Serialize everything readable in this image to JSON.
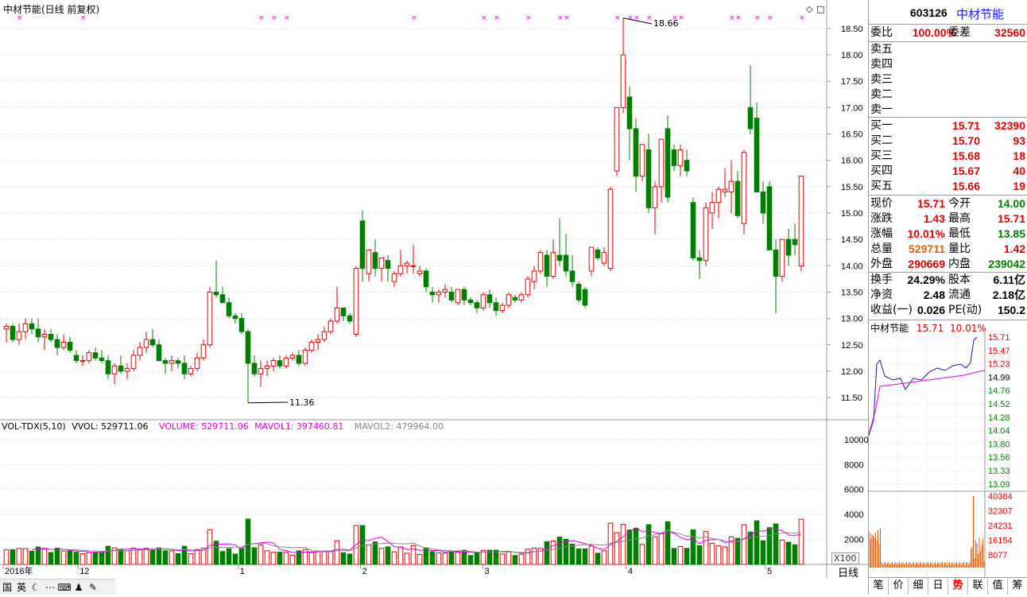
{
  "chart_title": "中材节能(日线 前复权)",
  "price_axis": [
    "18.50",
    "18.00",
    "17.50",
    "17.00",
    "16.50",
    "16.00",
    "15.50",
    "15.00",
    "14.50",
    "14.00",
    "13.50",
    "13.00",
    "12.50",
    "12.00",
    "11.50"
  ],
  "high_label": "18.66",
  "low_label": "11.36",
  "volume_header": {
    "indicator": "VOL-TDX(5,10)",
    "vvol": "VVOL: 529711.06",
    "volume": "VOLUME: 529711.06",
    "mavol1": "MAVOL1: 397460.81",
    "mavol2": "MAVOL2: 479964.00"
  },
  "vol_axis": [
    "10000",
    "8000",
    "6000",
    "4000",
    "2000"
  ],
  "vol_unit": "X100",
  "date_axis": [
    "2016年",
    "12",
    "1",
    "2",
    "3",
    "4",
    "5"
  ],
  "period_label": "日线",
  "toolbar_icons": [
    "国",
    "英",
    "moon-icon",
    "dots-icon",
    "keyboard-icon",
    "user-icon",
    "wrench-icon"
  ],
  "stock": {
    "code": "603126",
    "name": "中材节能"
  },
  "commission": {
    "ratio_label": "委比",
    "ratio": "100.00%",
    "diff_label": "委差",
    "diff": "32560"
  },
  "sell": [
    {
      "label": "卖五"
    },
    {
      "label": "卖四"
    },
    {
      "label": "卖三"
    },
    {
      "label": "卖二"
    },
    {
      "label": "卖一"
    }
  ],
  "buy": [
    {
      "label": "买一",
      "price": "15.71",
      "vol": "32390"
    },
    {
      "label": "买二",
      "price": "15.70",
      "vol": "93"
    },
    {
      "label": "买三",
      "price": "15.68",
      "vol": "18"
    },
    {
      "label": "买四",
      "price": "15.67",
      "vol": "40"
    },
    {
      "label": "买五",
      "price": "15.66",
      "vol": "19"
    }
  ],
  "quote": [
    {
      "l1": "现价",
      "v1": "15.71",
      "l2": "今开",
      "v2": "14.00",
      "c1": "red",
      "c2": "green"
    },
    {
      "l1": "涨跌",
      "v1": "1.43",
      "l2": "最高",
      "v2": "15.71",
      "c1": "red",
      "c2": "red"
    },
    {
      "l1": "涨幅",
      "v1": "10.01%",
      "l2": "最低",
      "v2": "13.85",
      "c1": "red",
      "c2": "green"
    },
    {
      "l1": "总量",
      "v1": "529711",
      "l2": "量比",
      "v2": "1.42",
      "c1": "orange",
      "c2": "red"
    },
    {
      "l1": "外盘",
      "v1": "290669",
      "l2": "内盘",
      "v2": "239042",
      "c1": "red",
      "c2": "green"
    }
  ],
  "stats": [
    {
      "l1": "换手",
      "v1": "24.29%",
      "l2": "股本",
      "v2": "6.11亿"
    },
    {
      "l1": "净资",
      "v1": "2.48",
      "l2": "流通",
      "v2": "2.18亿"
    },
    {
      "l1": "收益(一)",
      "v1": "0.026",
      "l2": "PE(动)",
      "v2": "150.2"
    }
  ],
  "mini": {
    "name": "中材节能",
    "price": "15.71",
    "pct": "10.01%",
    "price_axis": [
      "15.71",
      "15.47",
      "15.23",
      "14.99",
      "14.76",
      "14.52",
      "14.28",
      "14.04",
      "13.80",
      "13.56",
      "13.33",
      "13.09"
    ],
    "vol_axis": [
      "40384",
      "32307",
      "24231",
      "16154",
      "8077"
    ]
  },
  "tabs": [
    "笔",
    "价",
    "细",
    "日",
    "势",
    "联",
    "值",
    "筹"
  ],
  "active_tab": "势",
  "colors": {
    "up": "#e60000",
    "down": "#008000",
    "ma1": "#e600e6",
    "ma2": "#888888",
    "grid": "#cccccc",
    "axis": "#999999"
  },
  "chart_data": {
    "type": "candlestick",
    "title": "中材节能(日线 前复权)",
    "ylim": [
      11.2,
      18.8
    ],
    "ohlc": [
      [
        12.8,
        12.9,
        12.55,
        12.85
      ],
      [
        12.85,
        12.9,
        12.55,
        12.6
      ],
      [
        12.6,
        12.9,
        12.5,
        12.75
      ],
      [
        12.75,
        13.0,
        12.6,
        12.9
      ],
      [
        12.9,
        13.0,
        12.7,
        12.8
      ],
      [
        12.8,
        13.0,
        12.55,
        12.65
      ],
      [
        12.65,
        12.8,
        12.4,
        12.7
      ],
      [
        12.7,
        12.8,
        12.55,
        12.6
      ],
      [
        12.6,
        12.7,
        12.3,
        12.45
      ],
      [
        12.45,
        12.7,
        12.4,
        12.55
      ],
      [
        12.55,
        12.65,
        12.35,
        12.4
      ],
      [
        12.3,
        12.4,
        12.15,
        12.2
      ],
      [
        12.2,
        12.3,
        12.1,
        12.2
      ],
      [
        12.2,
        12.4,
        12.15,
        12.35
      ],
      [
        12.35,
        12.45,
        12.2,
        12.25
      ],
      [
        12.25,
        12.4,
        12.15,
        12.2
      ],
      [
        12.2,
        12.3,
        11.85,
        11.95
      ],
      [
        11.95,
        12.15,
        11.75,
        12.1
      ],
      [
        12.1,
        12.3,
        11.95,
        12.0
      ],
      [
        12.0,
        12.15,
        11.85,
        12.05
      ],
      [
        12.05,
        12.4,
        12.0,
        12.3
      ],
      [
        12.3,
        12.55,
        12.2,
        12.45
      ],
      [
        12.45,
        12.75,
        12.35,
        12.6
      ],
      [
        12.6,
        12.8,
        12.45,
        12.5
      ],
      [
        12.5,
        12.6,
        12.2,
        12.2
      ],
      [
        12.2,
        12.25,
        11.95,
        12.15
      ],
      [
        12.15,
        12.3,
        12.0,
        12.2
      ],
      [
        12.2,
        12.25,
        12.05,
        12.15
      ],
      [
        12.15,
        12.3,
        11.85,
        11.95
      ],
      [
        11.95,
        12.1,
        11.9,
        12.05
      ],
      [
        12.05,
        12.35,
        12.0,
        12.25
      ],
      [
        12.25,
        12.6,
        12.2,
        12.5
      ],
      [
        12.5,
        13.6,
        12.45,
        13.5
      ],
      [
        13.5,
        14.1,
        13.4,
        13.45
      ],
      [
        13.45,
        13.6,
        13.3,
        13.3
      ],
      [
        13.3,
        13.4,
        13.0,
        13.05
      ],
      [
        13.05,
        13.1,
        12.9,
        13.0
      ],
      [
        13.0,
        13.1,
        12.7,
        12.75
      ],
      [
        12.75,
        12.8,
        11.4,
        12.15
      ],
      [
        12.15,
        12.3,
        11.9,
        11.95
      ],
      [
        11.95,
        12.2,
        11.7,
        12.05
      ],
      [
        12.05,
        12.2,
        11.9,
        12.1
      ],
      [
        12.1,
        12.25,
        12.0,
        12.2
      ],
      [
        12.2,
        12.3,
        12.05,
        12.1
      ],
      [
        12.1,
        12.3,
        12.05,
        12.25
      ],
      [
        12.25,
        12.35,
        12.2,
        12.3
      ],
      [
        12.3,
        12.4,
        12.1,
        12.15
      ],
      [
        12.15,
        12.45,
        12.1,
        12.4
      ],
      [
        12.4,
        12.6,
        12.35,
        12.55
      ],
      [
        12.55,
        12.7,
        12.4,
        12.6
      ],
      [
        12.6,
        12.85,
        12.55,
        12.75
      ],
      [
        12.75,
        13.0,
        12.7,
        12.95
      ],
      [
        12.95,
        13.6,
        12.9,
        13.2
      ],
      [
        13.2,
        13.2,
        12.95,
        13.05
      ],
      [
        13.05,
        13.1,
        12.9,
        12.95
      ],
      [
        12.7,
        14.0,
        12.65,
        13.95
      ],
      [
        14.85,
        15.05,
        13.7,
        13.95
      ],
      [
        13.85,
        14.3,
        13.7,
        14.3
      ],
      [
        14.25,
        14.5,
        13.8,
        13.95
      ],
      [
        13.95,
        14.15,
        13.7,
        14.15
      ],
      [
        14.1,
        14.2,
        13.7,
        13.95
      ],
      [
        13.7,
        13.9,
        13.6,
        13.85
      ],
      [
        13.85,
        14.3,
        13.8,
        14.0
      ],
      [
        14.0,
        14.1,
        13.85,
        14.05
      ],
      [
        14.0,
        14.4,
        13.85,
        14.0
      ],
      [
        13.85,
        14.0,
        13.8,
        13.9
      ],
      [
        13.9,
        13.95,
        13.5,
        13.6
      ],
      [
        13.5,
        13.6,
        13.3,
        13.45
      ],
      [
        13.45,
        13.55,
        13.3,
        13.5
      ],
      [
        13.5,
        13.65,
        13.4,
        13.55
      ],
      [
        13.5,
        13.6,
        13.3,
        13.35
      ],
      [
        13.3,
        13.55,
        13.25,
        13.55
      ],
      [
        13.55,
        13.6,
        13.25,
        13.35
      ],
      [
        13.35,
        13.4,
        13.25,
        13.3
      ],
      [
        13.3,
        13.35,
        13.1,
        13.2
      ],
      [
        13.2,
        13.5,
        13.15,
        13.45
      ],
      [
        13.45,
        13.55,
        13.2,
        13.3
      ],
      [
        13.3,
        13.4,
        13.05,
        13.15
      ],
      [
        13.15,
        13.3,
        13.1,
        13.25
      ],
      [
        13.25,
        13.5,
        13.2,
        13.45
      ],
      [
        13.4,
        13.45,
        13.3,
        13.35
      ],
      [
        13.35,
        13.5,
        13.3,
        13.45
      ],
      [
        13.45,
        13.8,
        13.4,
        13.75
      ],
      [
        13.7,
        14.0,
        13.55,
        13.9
      ],
      [
        13.9,
        14.3,
        13.85,
        14.25
      ],
      [
        14.2,
        14.3,
        13.6,
        13.8
      ],
      [
        13.8,
        14.5,
        13.75,
        14.25
      ],
      [
        14.2,
        14.9,
        14.0,
        14.1
      ],
      [
        14.2,
        14.6,
        13.8,
        13.9
      ],
      [
        13.9,
        14.2,
        13.6,
        13.7
      ],
      [
        13.65,
        13.7,
        13.3,
        13.35
      ],
      [
        13.55,
        13.6,
        13.2,
        13.25
      ],
      [
        13.9,
        14.35,
        13.8,
        14.35
      ],
      [
        14.3,
        14.35,
        14.1,
        14.15
      ],
      [
        14.05,
        14.35,
        14.0,
        14.25
      ],
      [
        13.95,
        15.5,
        13.9,
        15.45
      ],
      [
        15.8,
        17.0,
        15.7,
        17.0
      ],
      [
        17.0,
        18.7,
        16.9,
        18.0
      ],
      [
        17.2,
        17.4,
        16.0,
        16.6
      ],
      [
        16.6,
        16.8,
        15.4,
        15.7
      ],
      [
        15.7,
        16.3,
        15.6,
        16.3
      ],
      [
        16.2,
        16.5,
        15.0,
        15.1
      ],
      [
        15.1,
        15.6,
        14.6,
        15.5
      ],
      [
        15.5,
        16.4,
        15.2,
        16.4
      ],
      [
        16.6,
        16.85,
        15.2,
        15.3
      ],
      [
        16.2,
        16.3,
        15.8,
        15.9
      ],
      [
        15.9,
        16.3,
        15.7,
        16.2
      ],
      [
        16.0,
        16.2,
        15.7,
        15.8
      ],
      [
        15.2,
        15.3,
        14.1,
        14.15
      ],
      [
        14.15,
        14.3,
        13.75,
        14.1
      ],
      [
        14.1,
        15.2,
        14.0,
        15.1
      ],
      [
        15.0,
        15.4,
        14.7,
        15.2
      ],
      [
        15.2,
        15.5,
        14.9,
        15.45
      ],
      [
        15.4,
        15.85,
        15.3,
        15.45
      ],
      [
        15.4,
        16.0,
        15.0,
        15.6
      ],
      [
        15.6,
        15.8,
        14.9,
        14.95
      ],
      [
        14.8,
        16.2,
        14.6,
        16.15
      ],
      [
        17.0,
        17.8,
        16.5,
        16.6
      ],
      [
        16.8,
        17.1,
        15.4,
        15.4
      ],
      [
        15.4,
        15.6,
        14.8,
        15.0
      ],
      [
        15.5,
        15.6,
        14.3,
        14.3
      ],
      [
        14.3,
        14.5,
        13.1,
        13.8
      ],
      [
        13.8,
        14.5,
        13.7,
        14.5
      ],
      [
        14.5,
        14.7,
        14.0,
        14.2
      ],
      [
        14.5,
        14.8,
        14.2,
        14.4
      ],
      [
        14.0,
        15.7,
        13.9,
        15.7
      ]
    ],
    "volume_max": 10500
  }
}
